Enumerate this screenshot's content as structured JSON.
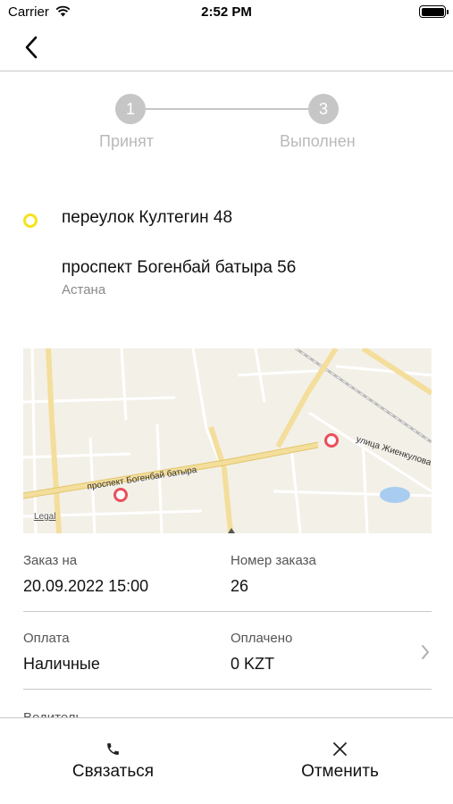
{
  "status_bar": {
    "carrier": "Carrier",
    "time": "2:52 PM"
  },
  "steps": [
    {
      "number": "1",
      "label": "Принят"
    },
    {
      "number": "3",
      "label": "Выполнен"
    }
  ],
  "route": {
    "from": "переулок Култегин 48",
    "to": "проспект Богенбай батыра 56",
    "to_city": "Астана",
    "from_marker_color": "#f6e21b"
  },
  "map": {
    "legal": "Legal",
    "street_main": "проспект Богенбай батыра",
    "street_side": "улица Жиенкулова",
    "marker_color": "#e8505b"
  },
  "details": {
    "order_for_label": "Заказ на",
    "order_for_value": "20.09.2022 15:00",
    "order_number_label": "Номер заказа",
    "order_number_value": "26",
    "payment_label": "Оплата",
    "payment_value": "Наличные",
    "paid_label": "Оплачено",
    "paid_value": "0 KZT",
    "driver_label": "Водитель"
  },
  "bottom_bar": {
    "contact_label": "Связаться",
    "cancel_label": "Отменить"
  }
}
